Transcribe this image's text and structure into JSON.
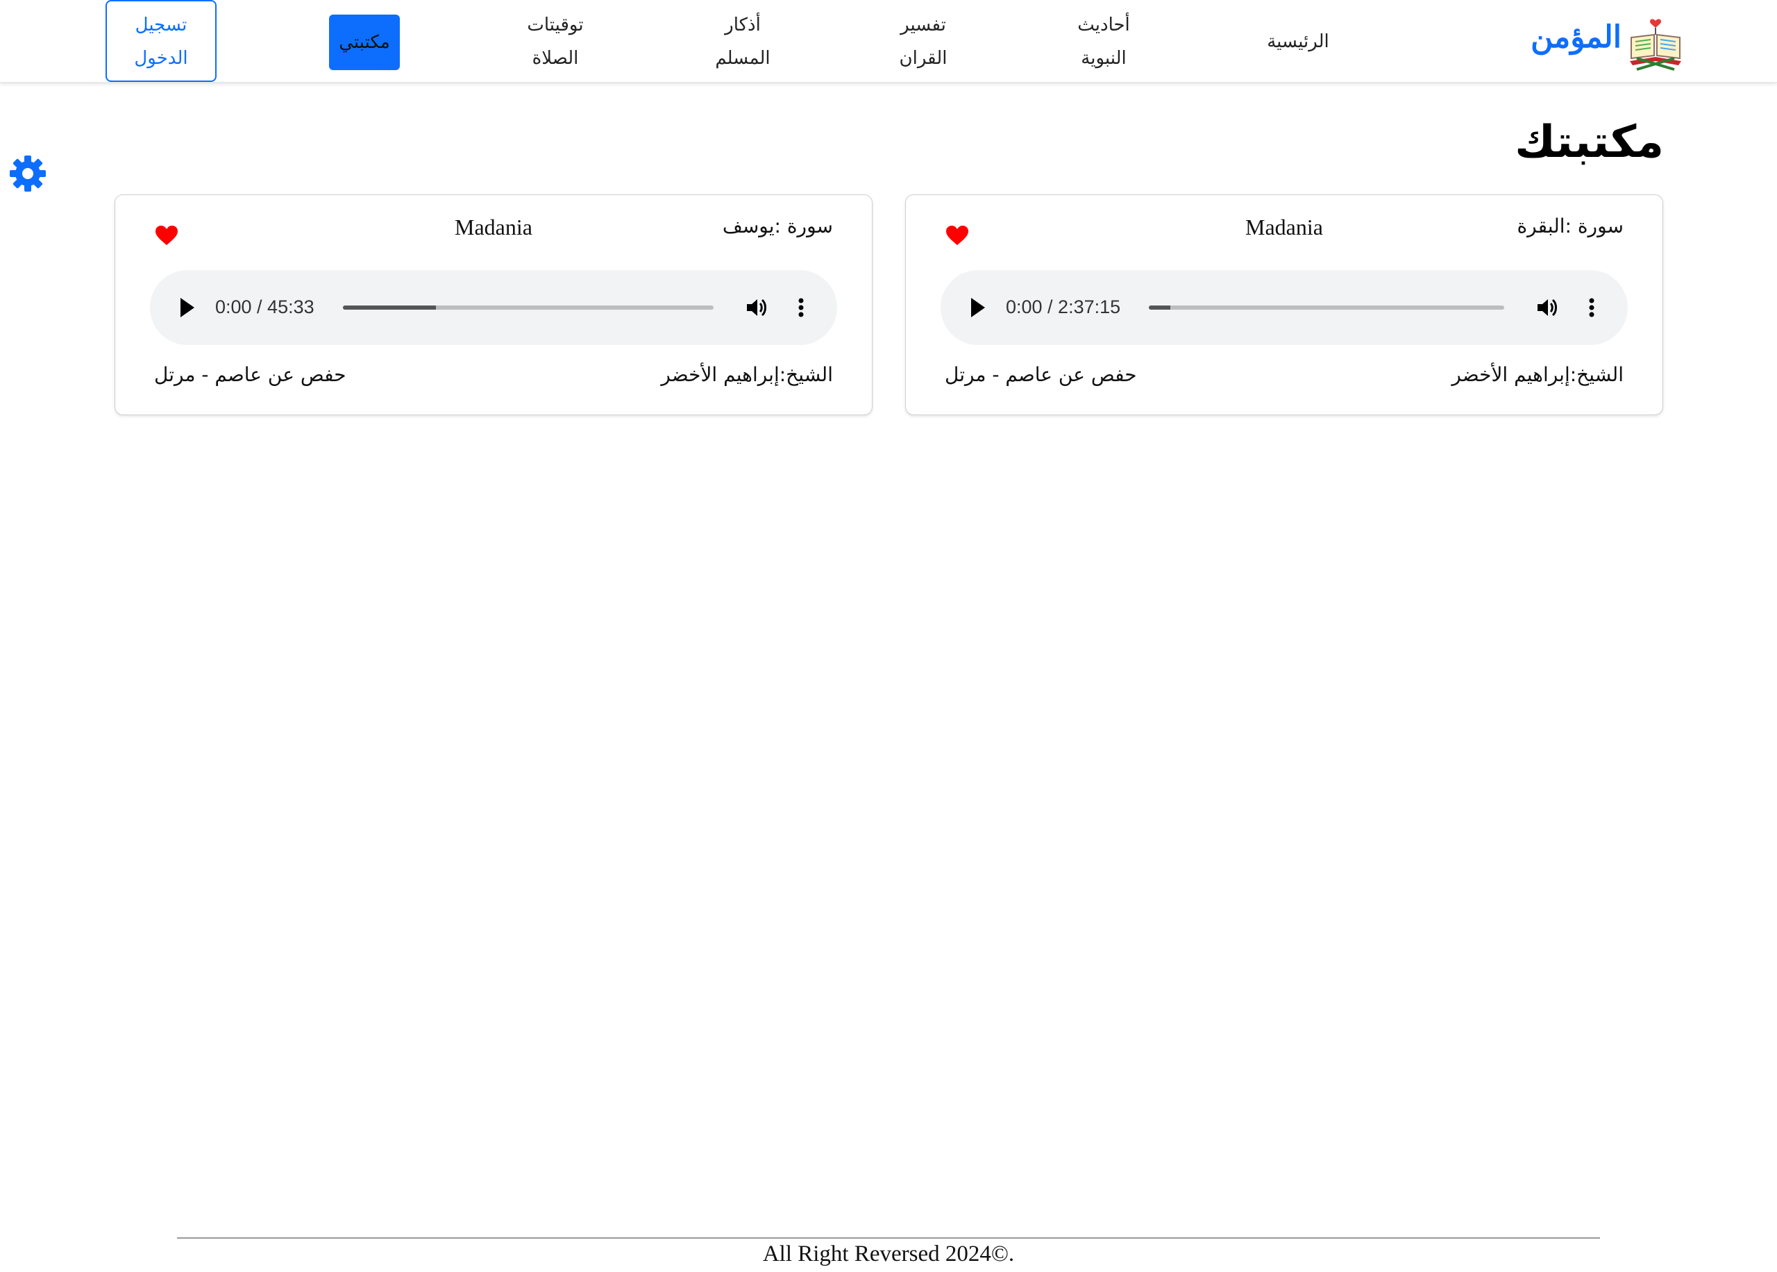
{
  "brand": {
    "name": "المؤمن",
    "logo_icon": "open-quran-book-icon",
    "color": "#0d6efd"
  },
  "nav": {
    "home": "الرئيسية",
    "hadith_line1": "أحاديث",
    "hadith_line2": "النبوية",
    "tafsir_line1": "تفسير",
    "tafsir_line2": "القران",
    "adhkar_line1": "أذكار",
    "adhkar_line2": "المسلم",
    "prayer_line1": "توقيتات",
    "prayer_line2": "الصلاة",
    "library": "مكتبتي",
    "login_line1": "تسجيل",
    "login_line2": "الدخول"
  },
  "settings_icon": "gear-icon",
  "page_title": "مكتبتك",
  "cards": [
    {
      "surah": "سورة :البقرة",
      "type": "Madania",
      "time": "0:00 / 2:37:15",
      "progress": 0.06,
      "sheikh": "الشيخ:إبراهيم الأخضر",
      "rewaya": "حفص عن عاصم - مرتل",
      "favorite": true
    },
    {
      "surah": "سورة :يوسف",
      "type": "Madania",
      "time": "0:00 / 45:33",
      "progress": 0.25,
      "sheikh": "الشيخ:إبراهيم الأخضر",
      "rewaya": "حفص عن عاصم - مرتل",
      "favorite": true
    }
  ],
  "colors": {
    "accent": "#0d6efd",
    "favorite": "#ff0000",
    "player_bg": "#f1f3f4"
  },
  "footer": {
    "text": "All Right Reversed 2024©."
  }
}
